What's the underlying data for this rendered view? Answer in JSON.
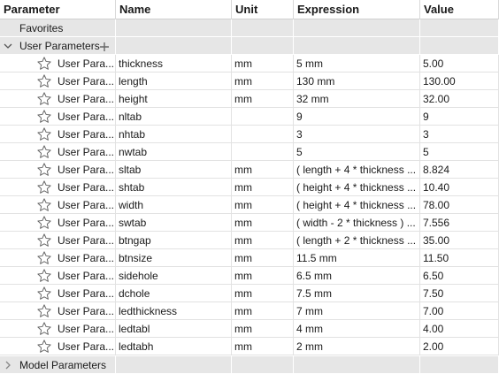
{
  "columns": {
    "parameter": "Parameter",
    "name": "Name",
    "unit": "Unit",
    "expression": "Expression",
    "value": "Value"
  },
  "groups": {
    "favorites": "Favorites",
    "user": "User Parameters",
    "model": "Model Parameters"
  },
  "icons": {
    "expanded": "chevron-down-icon",
    "collapsed": "chevron-right-icon",
    "add": "plus-icon",
    "favorite": "star-outline-icon"
  },
  "rows": [
    {
      "param": "User Para...",
      "name": "thickness",
      "unit": "mm",
      "expr": "5 mm",
      "value": "5.00"
    },
    {
      "param": "User Para...",
      "name": "length",
      "unit": "mm",
      "expr": "130 mm",
      "value": "130.00"
    },
    {
      "param": "User Para...",
      "name": "height",
      "unit": "mm",
      "expr": "32 mm",
      "value": "32.00"
    },
    {
      "param": "User Para...",
      "name": "nltab",
      "unit": "",
      "expr": "9",
      "value": "9"
    },
    {
      "param": "User Para...",
      "name": "nhtab",
      "unit": "",
      "expr": "3",
      "value": "3"
    },
    {
      "param": "User Para...",
      "name": "nwtab",
      "unit": "",
      "expr": "5",
      "value": "5"
    },
    {
      "param": "User Para...",
      "name": "sltab",
      "unit": "mm",
      "expr": "( length + 4 * thickness ...",
      "value": "8.824"
    },
    {
      "param": "User Para...",
      "name": "shtab",
      "unit": "mm",
      "expr": "( height + 4 * thickness ...",
      "value": "10.40"
    },
    {
      "param": "User Para...",
      "name": "width",
      "unit": "mm",
      "expr": "( height + 4 * thickness ...",
      "value": "78.00"
    },
    {
      "param": "User Para...",
      "name": "swtab",
      "unit": "mm",
      "expr": "( width - 2 * thickness ) ...",
      "value": "7.556"
    },
    {
      "param": "User Para...",
      "name": "btngap",
      "unit": "mm",
      "expr": "( length + 2 * thickness ...",
      "value": "35.00"
    },
    {
      "param": "User Para...",
      "name": "btnsize",
      "unit": "mm",
      "expr": "11.5 mm",
      "value": "11.50"
    },
    {
      "param": "User Para...",
      "name": "sidehole",
      "unit": "mm",
      "expr": "6.5 mm",
      "value": "6.50"
    },
    {
      "param": "User Para...",
      "name": "dchole",
      "unit": "mm",
      "expr": "7.5 mm",
      "value": "7.50"
    },
    {
      "param": "User Para...",
      "name": "ledthickness",
      "unit": "mm",
      "expr": "7 mm",
      "value": "7.00"
    },
    {
      "param": "User Para...",
      "name": "ledtabl",
      "unit": "mm",
      "expr": "4 mm",
      "value": "4.00"
    },
    {
      "param": "User Para...",
      "name": "ledtabh",
      "unit": "mm",
      "expr": "2 mm",
      "value": "2.00"
    }
  ]
}
